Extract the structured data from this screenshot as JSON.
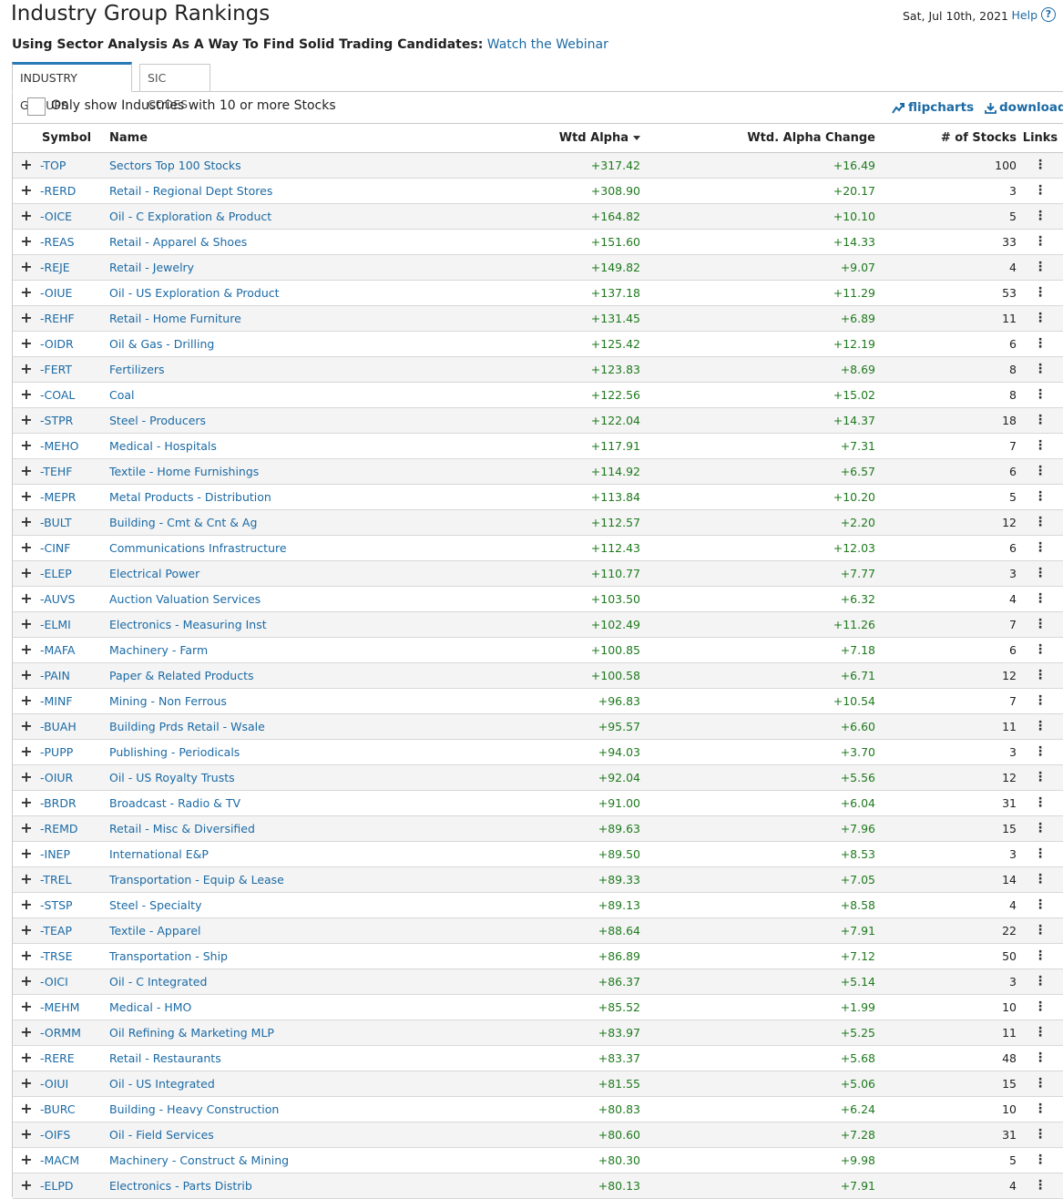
{
  "header": {
    "title": "Industry Group Rankings",
    "date": "Sat, Jul 10th, 2021",
    "help_label": "Help",
    "subtitle_bold": "Using Sector Analysis As A Way To Find Solid Trading Candidates:",
    "subtitle_link": "Watch the Webinar"
  },
  "tabs": [
    {
      "label": "INDUSTRY GROUPS",
      "active": true
    },
    {
      "label": "SIC CODES",
      "active": false
    }
  ],
  "filter": {
    "checkbox_label": "Only show Industries with 10 or more Stocks",
    "checked": false
  },
  "toolbar": {
    "flipcharts_label": "flipcharts",
    "download_label": "download"
  },
  "columns": {
    "symbol": "Symbol",
    "name": "Name",
    "wtd_alpha": "Wtd Alpha",
    "wtd_alpha_change": "Wtd. Alpha Change",
    "num_stocks": "# of Stocks",
    "links": "Links"
  },
  "rows": [
    {
      "symbol": "-TOP",
      "name": "Sectors Top 100 Stocks",
      "wtd_alpha": "+317.42",
      "change": "+16.49",
      "count": "100"
    },
    {
      "symbol": "-RERD",
      "name": "Retail - Regional Dept Stores",
      "wtd_alpha": "+308.90",
      "change": "+20.17",
      "count": "3"
    },
    {
      "symbol": "-OICE",
      "name": "Oil - C Exploration & Product",
      "wtd_alpha": "+164.82",
      "change": "+10.10",
      "count": "5"
    },
    {
      "symbol": "-REAS",
      "name": "Retail - Apparel & Shoes",
      "wtd_alpha": "+151.60",
      "change": "+14.33",
      "count": "33"
    },
    {
      "symbol": "-REJE",
      "name": "Retail - Jewelry",
      "wtd_alpha": "+149.82",
      "change": "+9.07",
      "count": "4"
    },
    {
      "symbol": "-OIUE",
      "name": "Oil - US Exploration & Product",
      "wtd_alpha": "+137.18",
      "change": "+11.29",
      "count": "53"
    },
    {
      "symbol": "-REHF",
      "name": "Retail - Home Furniture",
      "wtd_alpha": "+131.45",
      "change": "+6.89",
      "count": "11"
    },
    {
      "symbol": "-OIDR",
      "name": "Oil & Gas - Drilling",
      "wtd_alpha": "+125.42",
      "change": "+12.19",
      "count": "6"
    },
    {
      "symbol": "-FERT",
      "name": "Fertilizers",
      "wtd_alpha": "+123.83",
      "change": "+8.69",
      "count": "8"
    },
    {
      "symbol": "-COAL",
      "name": "Coal",
      "wtd_alpha": "+122.56",
      "change": "+15.02",
      "count": "8"
    },
    {
      "symbol": "-STPR",
      "name": "Steel - Producers",
      "wtd_alpha": "+122.04",
      "change": "+14.37",
      "count": "18"
    },
    {
      "symbol": "-MEHO",
      "name": "Medical - Hospitals",
      "wtd_alpha": "+117.91",
      "change": "+7.31",
      "count": "7"
    },
    {
      "symbol": "-TEHF",
      "name": "Textile - Home Furnishings",
      "wtd_alpha": "+114.92",
      "change": "+6.57",
      "count": "6"
    },
    {
      "symbol": "-MEPR",
      "name": "Metal Products - Distribution",
      "wtd_alpha": "+113.84",
      "change": "+10.20",
      "count": "5"
    },
    {
      "symbol": "-BULT",
      "name": "Building - Cmt & Cnt & Ag",
      "wtd_alpha": "+112.57",
      "change": "+2.20",
      "count": "12"
    },
    {
      "symbol": "-CINF",
      "name": "Communications Infrastructure",
      "wtd_alpha": "+112.43",
      "change": "+12.03",
      "count": "6"
    },
    {
      "symbol": "-ELEP",
      "name": "Electrical Power",
      "wtd_alpha": "+110.77",
      "change": "+7.77",
      "count": "3"
    },
    {
      "symbol": "-AUVS",
      "name": "Auction Valuation Services",
      "wtd_alpha": "+103.50",
      "change": "+6.32",
      "count": "4"
    },
    {
      "symbol": "-ELMI",
      "name": "Electronics - Measuring Inst",
      "wtd_alpha": "+102.49",
      "change": "+11.26",
      "count": "7"
    },
    {
      "symbol": "-MAFA",
      "name": "Machinery - Farm",
      "wtd_alpha": "+100.85",
      "change": "+7.18",
      "count": "6"
    },
    {
      "symbol": "-PAIN",
      "name": "Paper & Related Products",
      "wtd_alpha": "+100.58",
      "change": "+6.71",
      "count": "12"
    },
    {
      "symbol": "-MINF",
      "name": "Mining - Non Ferrous",
      "wtd_alpha": "+96.83",
      "change": "+10.54",
      "count": "7"
    },
    {
      "symbol": "-BUAH",
      "name": "Building Prds Retail - Wsale",
      "wtd_alpha": "+95.57",
      "change": "+6.60",
      "count": "11"
    },
    {
      "symbol": "-PUPP",
      "name": "Publishing - Periodicals",
      "wtd_alpha": "+94.03",
      "change": "+3.70",
      "count": "3"
    },
    {
      "symbol": "-OIUR",
      "name": "Oil - US Royalty Trusts",
      "wtd_alpha": "+92.04",
      "change": "+5.56",
      "count": "12"
    },
    {
      "symbol": "-BRDR",
      "name": "Broadcast - Radio & TV",
      "wtd_alpha": "+91.00",
      "change": "+6.04",
      "count": "31"
    },
    {
      "symbol": "-REMD",
      "name": "Retail - Misc & Diversified",
      "wtd_alpha": "+89.63",
      "change": "+7.96",
      "count": "15"
    },
    {
      "symbol": "-INEP",
      "name": "International E&P",
      "wtd_alpha": "+89.50",
      "change": "+8.53",
      "count": "3"
    },
    {
      "symbol": "-TREL",
      "name": "Transportation - Equip & Lease",
      "wtd_alpha": "+89.33",
      "change": "+7.05",
      "count": "14"
    },
    {
      "symbol": "-STSP",
      "name": "Steel - Specialty",
      "wtd_alpha": "+89.13",
      "change": "+8.58",
      "count": "4"
    },
    {
      "symbol": "-TEAP",
      "name": "Textile - Apparel",
      "wtd_alpha": "+88.64",
      "change": "+7.91",
      "count": "22"
    },
    {
      "symbol": "-TRSE",
      "name": "Transportation - Ship",
      "wtd_alpha": "+86.89",
      "change": "+7.12",
      "count": "50"
    },
    {
      "symbol": "-OICI",
      "name": "Oil - C Integrated",
      "wtd_alpha": "+86.37",
      "change": "+5.14",
      "count": "3"
    },
    {
      "symbol": "-MEHM",
      "name": "Medical - HMO",
      "wtd_alpha": "+85.52",
      "change": "+1.99",
      "count": "10"
    },
    {
      "symbol": "-ORMM",
      "name": "Oil Refining & Marketing MLP",
      "wtd_alpha": "+83.97",
      "change": "+5.25",
      "count": "11"
    },
    {
      "symbol": "-RERE",
      "name": "Retail - Restaurants",
      "wtd_alpha": "+83.37",
      "change": "+5.68",
      "count": "48"
    },
    {
      "symbol": "-OIUI",
      "name": "Oil - US Integrated",
      "wtd_alpha": "+81.55",
      "change": "+5.06",
      "count": "15"
    },
    {
      "symbol": "-BURC",
      "name": "Building - Heavy Construction",
      "wtd_alpha": "+80.83",
      "change": "+6.24",
      "count": "10"
    },
    {
      "symbol": "-OIFS",
      "name": "Oil - Field Services",
      "wtd_alpha": "+80.60",
      "change": "+7.28",
      "count": "31"
    },
    {
      "symbol": "-MACM",
      "name": "Machinery - Construct & Mining",
      "wtd_alpha": "+80.30",
      "change": "+9.98",
      "count": "5"
    },
    {
      "symbol": "-ELPD",
      "name": "Electronics - Parts Distrib",
      "wtd_alpha": "+80.13",
      "change": "+7.91",
      "count": "4"
    }
  ],
  "colors": {
    "link": "#1b6aa5",
    "positive": "#1e7a1e",
    "tab_accent": "#2a7ab8"
  }
}
